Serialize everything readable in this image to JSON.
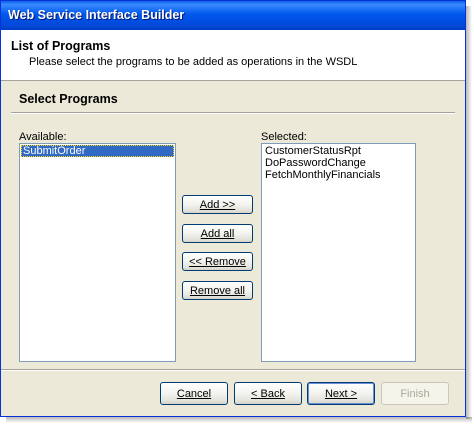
{
  "window": {
    "title": "Web Service Interface Builder"
  },
  "header": {
    "title": "List of Programs",
    "subtitle": "Please select the programs to be added as operations in the WSDL"
  },
  "section": {
    "title": "Select Programs"
  },
  "available": {
    "label": "Available:",
    "items": [
      {
        "label": "SubmitOrder",
        "selected": true
      }
    ]
  },
  "selected": {
    "label": "Selected:",
    "items": [
      {
        "label": "CustomerStatusRpt"
      },
      {
        "label": "DoPasswordChange"
      },
      {
        "label": "FetchMonthlyFinancials"
      }
    ]
  },
  "buttons": {
    "add": "Add >>",
    "add_all": "Add all",
    "remove": "<< Remove",
    "remove_all": "Remove all"
  },
  "footer": {
    "cancel": "Cancel",
    "back": "< Back",
    "next": "Next >",
    "finish": "Finish"
  },
  "colors": {
    "titlebar": "#0058ee",
    "dialog": "#ece9d8",
    "selection": "#316ac5"
  }
}
